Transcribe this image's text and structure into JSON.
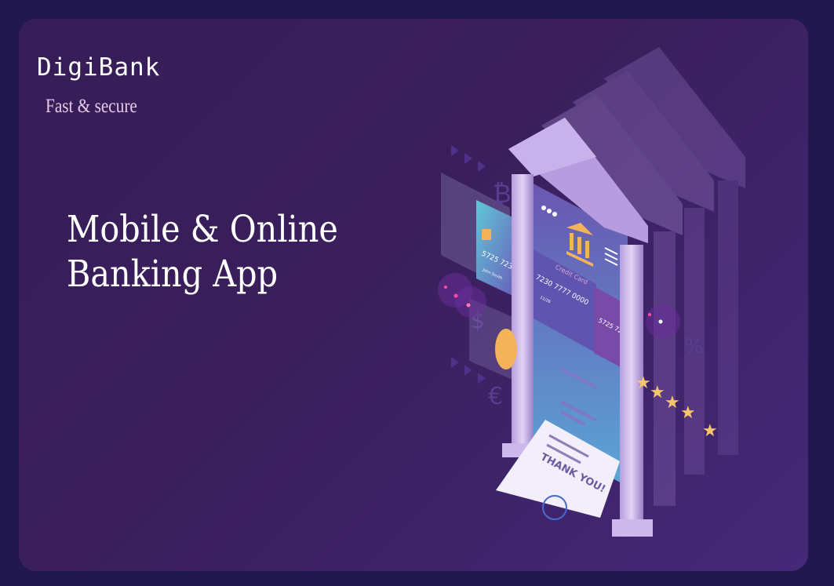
{
  "brand": {
    "name": "DigiBank",
    "tagline": "Fast & secure"
  },
  "hero": {
    "line1": "Mobile & Online",
    "line2": "Banking App"
  },
  "illustration": {
    "credit_card_label": "Credit Card",
    "card_number_main": "7230 7777 0000",
    "card_expiry": "11/26",
    "card_number_side": "5725 723",
    "card_holder": "John Smith",
    "receipt_text": "THANK YOU!",
    "currency_symbols": [
      "₿",
      "$",
      "€",
      "%"
    ],
    "rating_stars": 5,
    "colors": {
      "background": "#221850",
      "panel": "#3a1f5c",
      "accent_gold": "#f3b35a",
      "pillar": "#c9b2e6"
    }
  }
}
